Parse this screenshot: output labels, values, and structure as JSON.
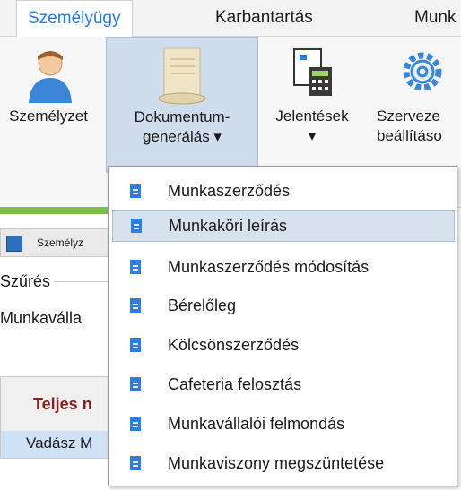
{
  "tabs": [
    "Személyügy",
    "Karbantartás",
    "Munk"
  ],
  "ribbon": {
    "personnel": "Személyzet",
    "docgen_line1": "Dokumentum-",
    "docgen_line2": "generálás ▾",
    "reports_line1": "Jelentések",
    "reports_line2": "▾",
    "org_line1": "Szerveze",
    "org_line2": "beállításo"
  },
  "background": {
    "doc_tab": "Személyz",
    "filter_label": "Szűrés",
    "employee_label": "Munkaválla",
    "grid_header": "Teljes n",
    "grid_row": "Vadász M"
  },
  "menu": [
    "Munkaszerződés",
    "Munkaköri leírás",
    "Munkaszerződés módosítás",
    "Bérelőleg",
    "Kölcsönszerződés",
    "Cafeteria felosztás",
    "Munkavállalói felmondás",
    "Munkaviszony megszüntetése"
  ],
  "highlighted_item": "Munkaköri leírás",
  "colors": {
    "accent": "#2a7bd3",
    "highlight": "#d7e2ef",
    "doc_icon": "#2e7de1",
    "green_bar": "#7cc04a"
  }
}
